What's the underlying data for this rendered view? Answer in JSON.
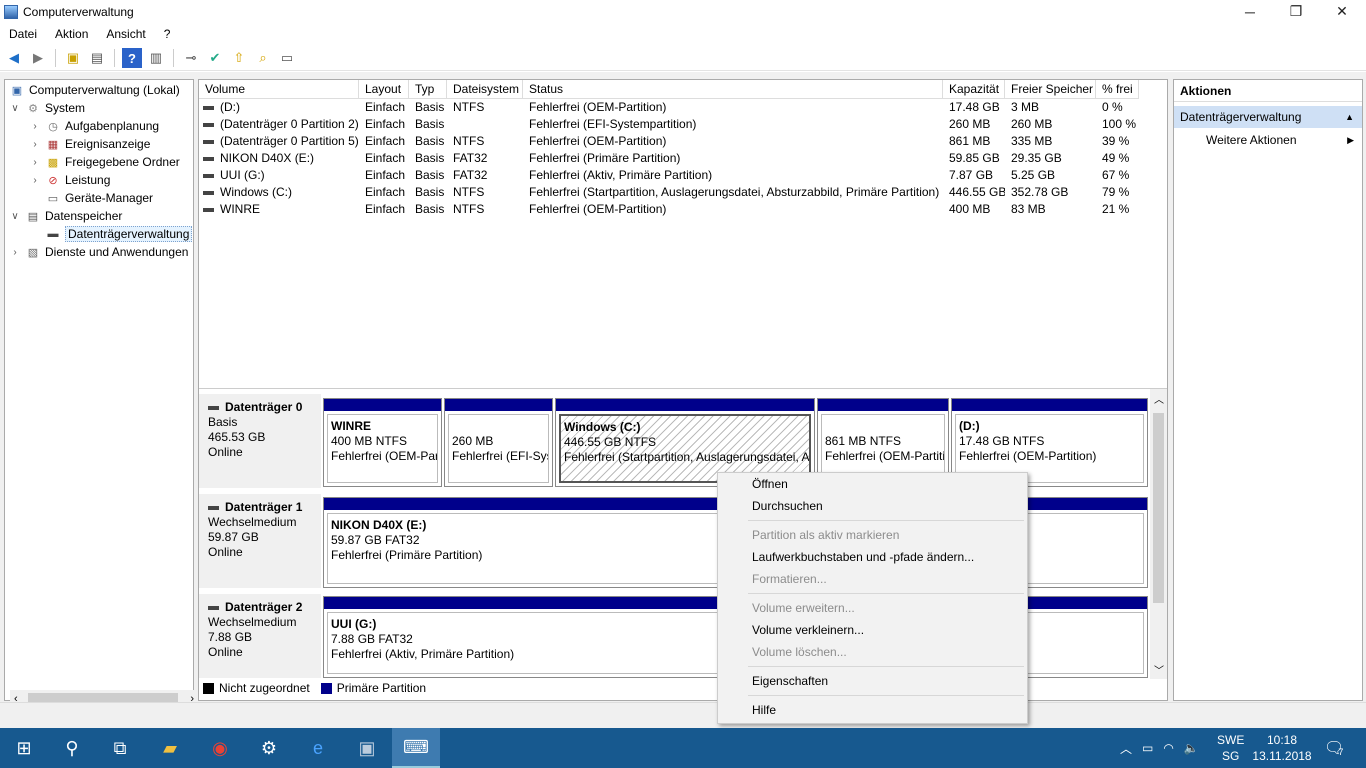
{
  "window": {
    "title": "Computerverwaltung",
    "minimize": "─",
    "maximize": "❐",
    "close": "✕"
  },
  "menu": [
    "Datei",
    "Aktion",
    "Ansicht",
    "?"
  ],
  "tree": {
    "root": "Computerverwaltung (Lokal)",
    "system": "System",
    "aufgaben": "Aufgabenplanung",
    "ereignis": "Ereignisanzeige",
    "ordner": "Freigegebene Ordner",
    "leistung": "Leistung",
    "geraete": "Geräte-Manager",
    "datenspeicher": "Datenspeicher",
    "dtv": "Datenträgerverwaltung",
    "dienste": "Dienste und Anwendungen"
  },
  "table": {
    "headers": [
      "Volume",
      "Layout",
      "Typ",
      "Dateisystem",
      "Status",
      "Kapazität",
      "Freier Speicher",
      "% frei"
    ],
    "rows": [
      [
        "(D:)",
        "Einfach",
        "Basis",
        "NTFS",
        "Fehlerfrei (OEM-Partition)",
        "17.48 GB",
        "3 MB",
        "0 %"
      ],
      [
        "(Datenträger 0 Partition 2)",
        "Einfach",
        "Basis",
        "",
        "Fehlerfrei (EFI-Systempartition)",
        "260 MB",
        "260 MB",
        "100 %"
      ],
      [
        "(Datenträger 0 Partition 5)",
        "Einfach",
        "Basis",
        "NTFS",
        "Fehlerfrei (OEM-Partition)",
        "861 MB",
        "335 MB",
        "39 %"
      ],
      [
        "NIKON D40X (E:)",
        "Einfach",
        "Basis",
        "FAT32",
        "Fehlerfrei (Primäre Partition)",
        "59.85 GB",
        "29.35 GB",
        "49 %"
      ],
      [
        "UUI (G:)",
        "Einfach",
        "Basis",
        "FAT32",
        "Fehlerfrei (Aktiv, Primäre Partition)",
        "7.87 GB",
        "5.25 GB",
        "67 %"
      ],
      [
        "Windows (C:)",
        "Einfach",
        "Basis",
        "NTFS",
        "Fehlerfrei (Startpartition, Auslagerungsdatei, Absturzabbild, Primäre Partition)",
        "446.55 GB",
        "352.78 GB",
        "79 %"
      ],
      [
        "WINRE",
        "Einfach",
        "Basis",
        "NTFS",
        "Fehlerfrei (OEM-Partition)",
        "400 MB",
        "83 MB",
        "21 %"
      ]
    ]
  },
  "disks": [
    {
      "name": "Datenträger 0",
      "type": "Basis",
      "size": "465.53 GB",
      "state": "Online"
    },
    {
      "name": "Datenträger 1",
      "type": "Wechselmedium",
      "size": "59.87 GB",
      "state": "Online"
    },
    {
      "name": "Datenträger 2",
      "type": "Wechselmedium",
      "size": "7.88 GB",
      "state": "Online"
    }
  ],
  "parts": {
    "winre": {
      "title": "WINRE",
      "size": "400 MB NTFS",
      "status": "Fehlerfrei (OEM-Par"
    },
    "efi": {
      "title": "",
      "size": "260 MB",
      "status": "Fehlerfrei (EFI-Syst"
    },
    "win": {
      "title": "Windows  (C:)",
      "size": "446.55 GB NTFS",
      "status": "Fehlerfrei (Startpartition, Auslagerungsdatei, Al"
    },
    "oem": {
      "title": "",
      "size": "861 MB NTFS",
      "status": "Fehlerfrei (OEM-Partiti"
    },
    "d": {
      "title": "(D:)",
      "size": "17.48 GB NTFS",
      "status": "Fehlerfrei (OEM-Partition)"
    },
    "e": {
      "title": "NIKON D40X  (E:)",
      "size": "59.87 GB FAT32",
      "status": "Fehlerfrei (Primäre Partition)"
    },
    "g": {
      "title": "UUI  (G:)",
      "size": "7.88 GB FAT32",
      "status": "Fehlerfrei (Aktiv, Primäre Partition)"
    }
  },
  "legend": {
    "unalloc": "Nicht zugeordnet",
    "primary": "Primäre Partition"
  },
  "actions": {
    "header": "Aktionen",
    "section": "Datenträgerverwaltung",
    "more": "Weitere Aktionen"
  },
  "context": {
    "open": "Öffnen",
    "explore": "Durchsuchen",
    "active": "Partition als aktiv markieren",
    "letter": "Laufwerkbuchstaben und -pfade ändern...",
    "format": "Formatieren...",
    "extend": "Volume erweitern...",
    "shrink": "Volume verkleinern...",
    "delete": "Volume löschen...",
    "props": "Eigenschaften",
    "help": "Hilfe"
  },
  "taskbar": {
    "lang1": "SWE",
    "lang2": "SG",
    "time": "10:18",
    "date": "13.11.2018",
    "notif": "7"
  },
  "colors": {
    "primary_partition": "#00008b",
    "taskbar": "#17598f"
  }
}
